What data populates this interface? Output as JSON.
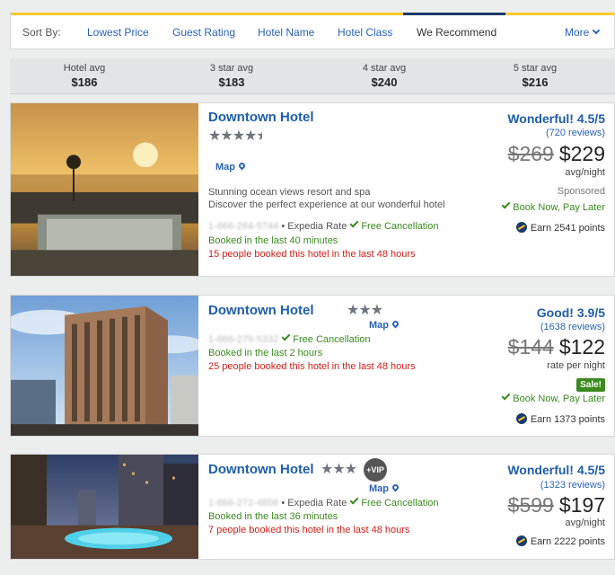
{
  "sort": {
    "label": "Sort By:",
    "options": [
      "Lowest Price",
      "Guest Rating",
      "Hotel Name",
      "Hotel Class",
      "We Recommend",
      "More"
    ],
    "active": "We Recommend"
  },
  "averages": [
    {
      "label": "Hotel avg",
      "value": "$186"
    },
    {
      "label": "3 star avg",
      "value": "$183"
    },
    {
      "label": "4 star avg",
      "value": "$240"
    },
    {
      "label": "5 star avg",
      "value": "$216"
    }
  ],
  "colors": {
    "accent": "#ffc72c",
    "link": "#1f5ea8",
    "green": "#3a8a1e",
    "red": "#d0211c"
  },
  "hotels": [
    {
      "name": "Downtown Hotel",
      "stars": "★★★★",
      "stars_extra": "★",
      "star_rating": 4.5,
      "map": "Map",
      "desc1": "Stunning ocean views resort and spa",
      "desc2": "Discover the perfect experience at our wonderful hotel",
      "phone": "1-866-264-5744",
      "rate_type": "• Expedia Rate",
      "free_cancel": "Free Cancellation",
      "booked": "Booked in the last 40 minutes",
      "people": "15 people booked this hotel in the last 48 hours",
      "rating": "Wonderful! 4.5/5",
      "reviews": "(720 reviews)",
      "old_price": "$269",
      "price": "$229",
      "price_note": "avg/night",
      "sponsored": "Sponsored",
      "book_now": "Book Now, Pay Later",
      "points": "Earn 2541 points"
    },
    {
      "name": "Downtown Hotel",
      "stars": "★★★",
      "star_rating": 3,
      "map": "Map",
      "phone": "1-866-279-5332",
      "free_cancel": "Free Cancellation",
      "booked": "Booked in the last 2 hours",
      "people": "25 people booked this hotel in the last 48 hours",
      "rating": "Good! 3.9/5",
      "reviews": "(1638 reviews)",
      "old_price": "$144",
      "price": "$122",
      "price_note": "rate per night",
      "sale": "Sale!",
      "book_now": "Book Now, Pay Later",
      "points": "Earn 1373 points"
    },
    {
      "name": "Downtown Hotel",
      "stars": "★★★",
      "star_rating": 3,
      "vip": "+VIP",
      "map": "Map",
      "phone": "1-866-272-4856",
      "rate_type": "• Expedia Rate",
      "free_cancel": "Free Cancellation",
      "booked": "Booked in the last 36 minutes",
      "people": "7 people booked this hotel in the last 48 hours",
      "rating": "Wonderful! 4.5/5",
      "reviews": "(1323 reviews)",
      "old_price": "$599",
      "price": "$197",
      "price_note": "avg/night",
      "points": "Earn 2222 points"
    }
  ]
}
